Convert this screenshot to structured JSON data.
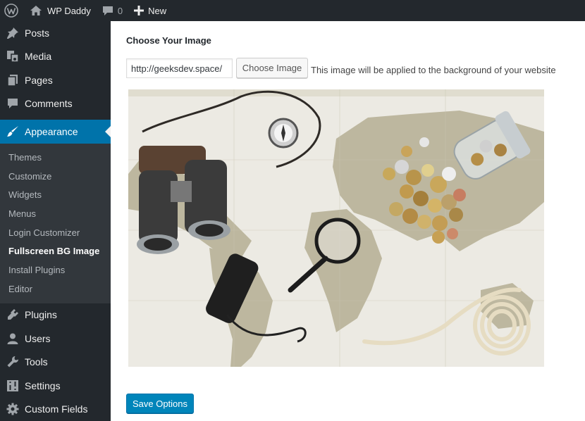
{
  "admin_bar": {
    "site_name": "WP Daddy",
    "comment_count": "0",
    "new_label": "New"
  },
  "sidebar": {
    "items_top": [
      {
        "label": "Posts",
        "icon": "pin-icon"
      },
      {
        "label": "Media",
        "icon": "media-icon"
      },
      {
        "label": "Pages",
        "icon": "pages-icon"
      },
      {
        "label": "Comments",
        "icon": "comments-icon"
      }
    ],
    "current": {
      "label": "Appearance",
      "icon": "brush-icon"
    },
    "submenu": [
      "Themes",
      "Customize",
      "Widgets",
      "Menus",
      "Login Customizer",
      "Fullscreen BG Image",
      "Install Plugins",
      "Editor"
    ],
    "submenu_current": "Fullscreen BG Image",
    "items_bottom": [
      {
        "label": "Plugins",
        "icon": "plugin-icon"
      },
      {
        "label": "Users",
        "icon": "users-icon"
      },
      {
        "label": "Tools",
        "icon": "wrench-icon"
      },
      {
        "label": "Settings",
        "icon": "settings-icon"
      },
      {
        "label": "Custom Fields",
        "icon": "gear-icon"
      }
    ]
  },
  "main": {
    "heading": "Choose Your Image",
    "url_value": "http://geeksdev.space/",
    "choose_button": "Choose Image",
    "help_text": "This image will be applied to the background of your website",
    "save_button": "Save Options"
  },
  "colors": {
    "admin_bg": "#23282d",
    "accent": "#0073aa",
    "button_primary": "#0085ba",
    "submenu_bg": "#32373c"
  }
}
